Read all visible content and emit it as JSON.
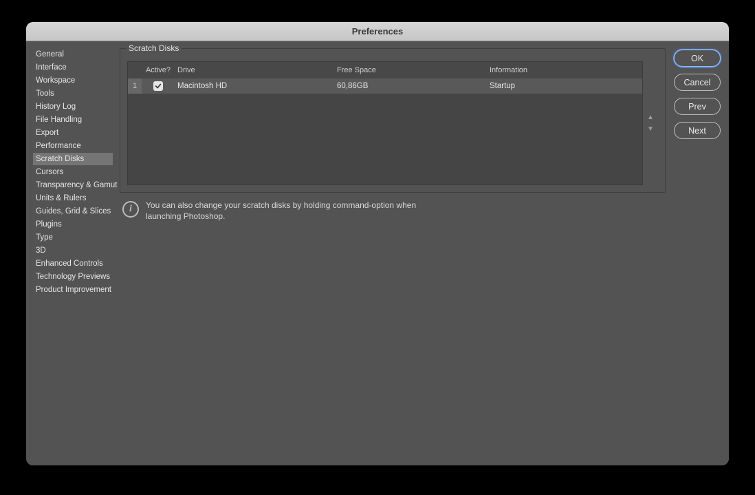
{
  "window": {
    "title": "Preferences"
  },
  "sidebar": {
    "items": [
      "General",
      "Interface",
      "Workspace",
      "Tools",
      "History Log",
      "File Handling",
      "Export",
      "Performance",
      "Scratch Disks",
      "Cursors",
      "Transparency & Gamut",
      "Units & Rulers",
      "Guides, Grid & Slices",
      "Plugins",
      "Type",
      "3D",
      "Enhanced Controls",
      "Technology Previews",
      "Product Improvement"
    ],
    "selected": "Scratch Disks"
  },
  "panel": {
    "title": "Scratch Disks",
    "columns": {
      "active": "Active?",
      "drive": "Drive",
      "free": "Free Space",
      "info": "Information"
    },
    "rows": [
      {
        "index": "1",
        "active": true,
        "drive": "Macintosh HD",
        "free": "60,86GB",
        "info": "Startup"
      }
    ],
    "hint": "You can also change your scratch disks by holding command-option when launching Photoshop."
  },
  "buttons": {
    "ok": "OK",
    "cancel": "Cancel",
    "prev": "Prev",
    "next": "Next"
  }
}
